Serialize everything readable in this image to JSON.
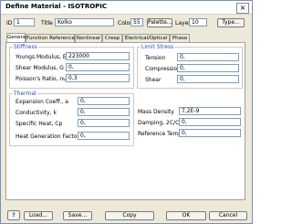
{
  "window": {
    "title": "Define Material - ISOTROPIC",
    "close_symbol": "×"
  },
  "header": {
    "id_label": "ID",
    "id_value": "1",
    "title_label": "Title",
    "title_value": "Kolko",
    "color_label": "Color",
    "color_value": "55",
    "palette_button": "Palette...",
    "layer_label": "Layer",
    "layer_value": "10",
    "type_button": "Type..."
  },
  "tabs": [
    "General",
    "Function References",
    "Nonlinear",
    "Creep",
    "Electrical/Optical",
    "Phase"
  ],
  "stiffness": {
    "title": "Stiffness",
    "rows": [
      {
        "label": "Youngs Modulus, E",
        "value": "223000"
      },
      {
        "label": "Shear Modulus, G",
        "value": "0,"
      },
      {
        "label": "Poisson's Ratio, nu",
        "value": "0,3"
      }
    ]
  },
  "limit_stress": {
    "title": "Limit Stress",
    "rows": [
      {
        "label": "Tension",
        "value": "0,"
      },
      {
        "label": "Compression",
        "value": "0,"
      },
      {
        "label": "Shear",
        "value": "0,"
      }
    ]
  },
  "thermal": {
    "title": "Thermal",
    "rows": [
      {
        "label": "Expansion Coeff., a",
        "value": "0,"
      },
      {
        "label": "Conductivity, k",
        "value": "0,"
      },
      {
        "label": "Specific Heat, Cp",
        "value": "0,"
      },
      {
        "label": "Heat Generation Factor",
        "value": "0,"
      }
    ]
  },
  "misc": {
    "rows": [
      {
        "label": "Mass Density",
        "value": "7,2E-9"
      },
      {
        "label": "Damping, 2C/Co",
        "value": "0,"
      },
      {
        "label": "Reference Temp",
        "value": "0,"
      }
    ]
  },
  "footer": {
    "help_icon_text": "?",
    "load_button": "Load...",
    "save_button": "Save...",
    "copy_button": "Copy",
    "ok_button": "OK",
    "cancel_button": "Cancel"
  },
  "colors": {
    "group_title": "#2c4cae",
    "field_border": "#7f9db9",
    "window_border": "#7a8fb8"
  }
}
